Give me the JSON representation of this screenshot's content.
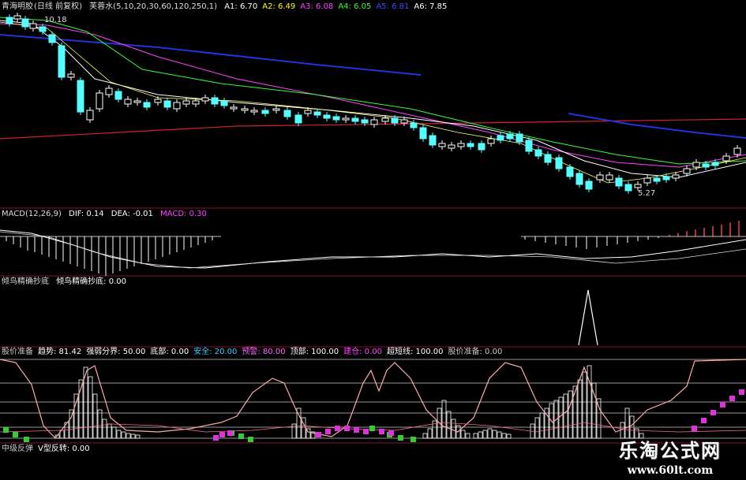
{
  "main_panel": {
    "stock_name": "青海明胶",
    "period": "(日线 前复权)",
    "indicator": "芙蓉水(5,10,20,30,60,120,250,1)",
    "ma_labels": [
      {
        "text": "A1: 6.70",
        "color": "#ffffff"
      },
      {
        "text": "A2: 6.49",
        "color": "#ffff00"
      },
      {
        "text": "A3: 6.08",
        "color": "#ff44ff"
      },
      {
        "text": "A4: 6.05",
        "color": "#33ff33"
      },
      {
        "text": "A5: 6.81",
        "color": "#4444ff"
      },
      {
        "text": "A6: 7.85",
        "color": "#ffffff"
      }
    ],
    "high_label": "10.18",
    "low_label": "5.27"
  },
  "macd_panel": {
    "name": "MACD(12,26,9)",
    "dif": "DIF: 0.14",
    "dea": "DEA: -0.01",
    "macd": "MACD: 0.30"
  },
  "signal_panel": {
    "name": "倾鸟精确抄底",
    "value": "倾鸟精确抄底: 0.00"
  },
  "oscillator_panel": {
    "labels": [
      {
        "text": "股价准备",
        "color": "#c8c8c8"
      },
      {
        "text": "趋势: 81.42",
        "color": "#ffffff"
      },
      {
        "text": "强弱分界: 50.00",
        "color": "#ffffff"
      },
      {
        "text": "底部: 0.00",
        "color": "#ffffff"
      },
      {
        "text": "安全: 20.00",
        "color": "#33ccff"
      },
      {
        "text": "预警: 80.00",
        "color": "#ff66ff"
      },
      {
        "text": "顶部: 100.00",
        "color": "#ffffff"
      },
      {
        "text": "建仓: 0.00",
        "color": "#ff44ff"
      },
      {
        "text": "超短线: 100.00",
        "color": "#ffffff"
      },
      {
        "text": "股价准备: 0.00",
        "color": "#c8c8c8"
      }
    ]
  },
  "bottom_panel": {
    "labels": [
      {
        "text": "中级反弹",
        "color": "#c8c8c8"
      },
      {
        "text": "V型反转: 0.00",
        "color": "#ffffff"
      }
    ]
  },
  "watermark": {
    "title": "乐淘公式网",
    "url": "www.60lt.com"
  },
  "colors": {
    "background": "#000000",
    "divider": "#8a1030",
    "candle_up": "#ffffff",
    "candle_down": "#55ffff",
    "ma_red": "#cc2233",
    "ma_blue": "#2233dd"
  }
}
